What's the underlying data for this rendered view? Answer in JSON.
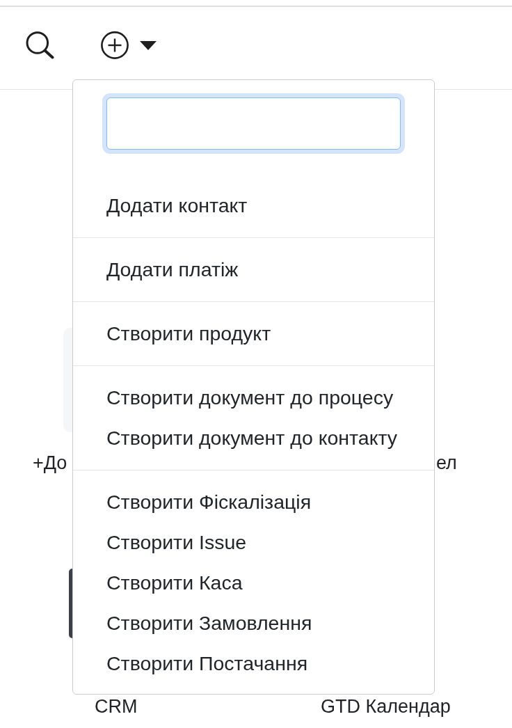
{
  "add_menu": {
    "filter_field": {
      "focused": true
    },
    "groups": [
      {
        "items": [
          {
            "label": "Додати контакт"
          }
        ]
      },
      {
        "items": [
          {
            "label": "Додати платіж"
          }
        ]
      },
      {
        "items": [
          {
            "label": "Створити продукт"
          }
        ]
      },
      {
        "items": [
          {
            "label": "Створити документ до процесу"
          },
          {
            "label": "Створити документ до контакту"
          }
        ]
      },
      {
        "items": [
          {
            "label": "Створити Фіскалізація"
          },
          {
            "label": "Створити Issue"
          },
          {
            "label": "Створити Каса"
          },
          {
            "label": "Створити Замовлення"
          },
          {
            "label": "Створити Постачання"
          }
        ]
      }
    ]
  },
  "app_grid": {
    "rows": [
      {
        "tiles": [
          {
            "label": "+До"
          },
          {
            "label": "ел"
          }
        ]
      },
      {
        "tiles": [
          {
            "label": "CRM"
          },
          {
            "label": "GTD Календар"
          }
        ]
      }
    ]
  }
}
